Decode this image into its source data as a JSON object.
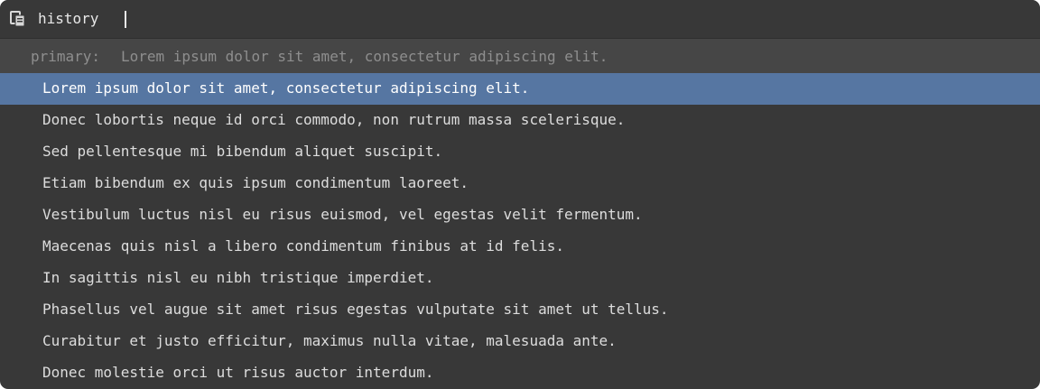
{
  "header": {
    "icon": "clipboard-icon",
    "title": "history"
  },
  "primary": {
    "label": "primary:",
    "text": "Lorem ipsum dolor sit amet, consectetur adipiscing elit."
  },
  "history": {
    "selected_index": 0,
    "items": [
      "Lorem ipsum dolor sit amet, consectetur adipiscing elit.",
      "Donec lobortis neque id orci commodo, non rutrum massa scelerisque.",
      "Sed pellentesque mi bibendum aliquet suscipit.",
      "Etiam bibendum ex quis ipsum condimentum laoreet.",
      "Vestibulum luctus nisl eu risus euismod, vel egestas velit fermentum.",
      "Maecenas quis nisl a libero condimentum finibus at id felis.",
      "In sagittis nisl eu nibh tristique imperdiet.",
      "Phasellus vel augue sit amet risus egestas vulputate sit amet ut tellus.",
      "Curabitur et justo efficitur, maximus nulla vitae, malesuada ante.",
      "Donec molestie orci ut risus auctor interdum."
    ]
  },
  "colors": {
    "background": "#383838",
    "primary_row": "#464646",
    "selection": "#5676a2",
    "text": "#dddddd",
    "muted_text": "#8e8e8e"
  }
}
